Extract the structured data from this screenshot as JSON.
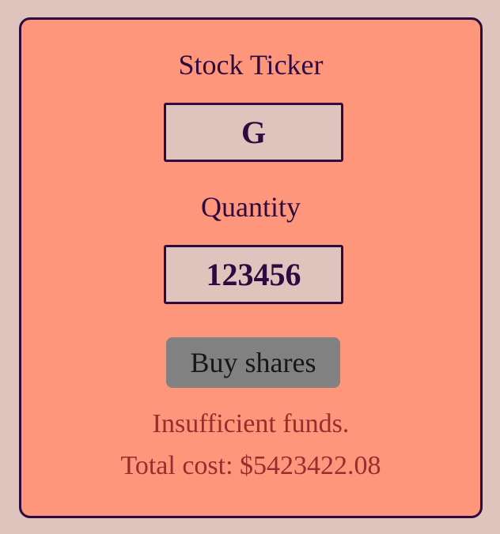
{
  "form": {
    "ticker_label": "Stock Ticker",
    "ticker_value": "G",
    "quantity_label": "Quantity",
    "quantity_value": "123456",
    "buy_label": "Buy shares"
  },
  "status": {
    "error": "Insufficient funds.",
    "total_cost": "Total cost: $5423422.08"
  },
  "colors": {
    "page_background": "#dfc3bd",
    "card_background": "#fe967c",
    "border": "#2d0a3f",
    "button": "#818181",
    "error_text": "#972d2d"
  }
}
